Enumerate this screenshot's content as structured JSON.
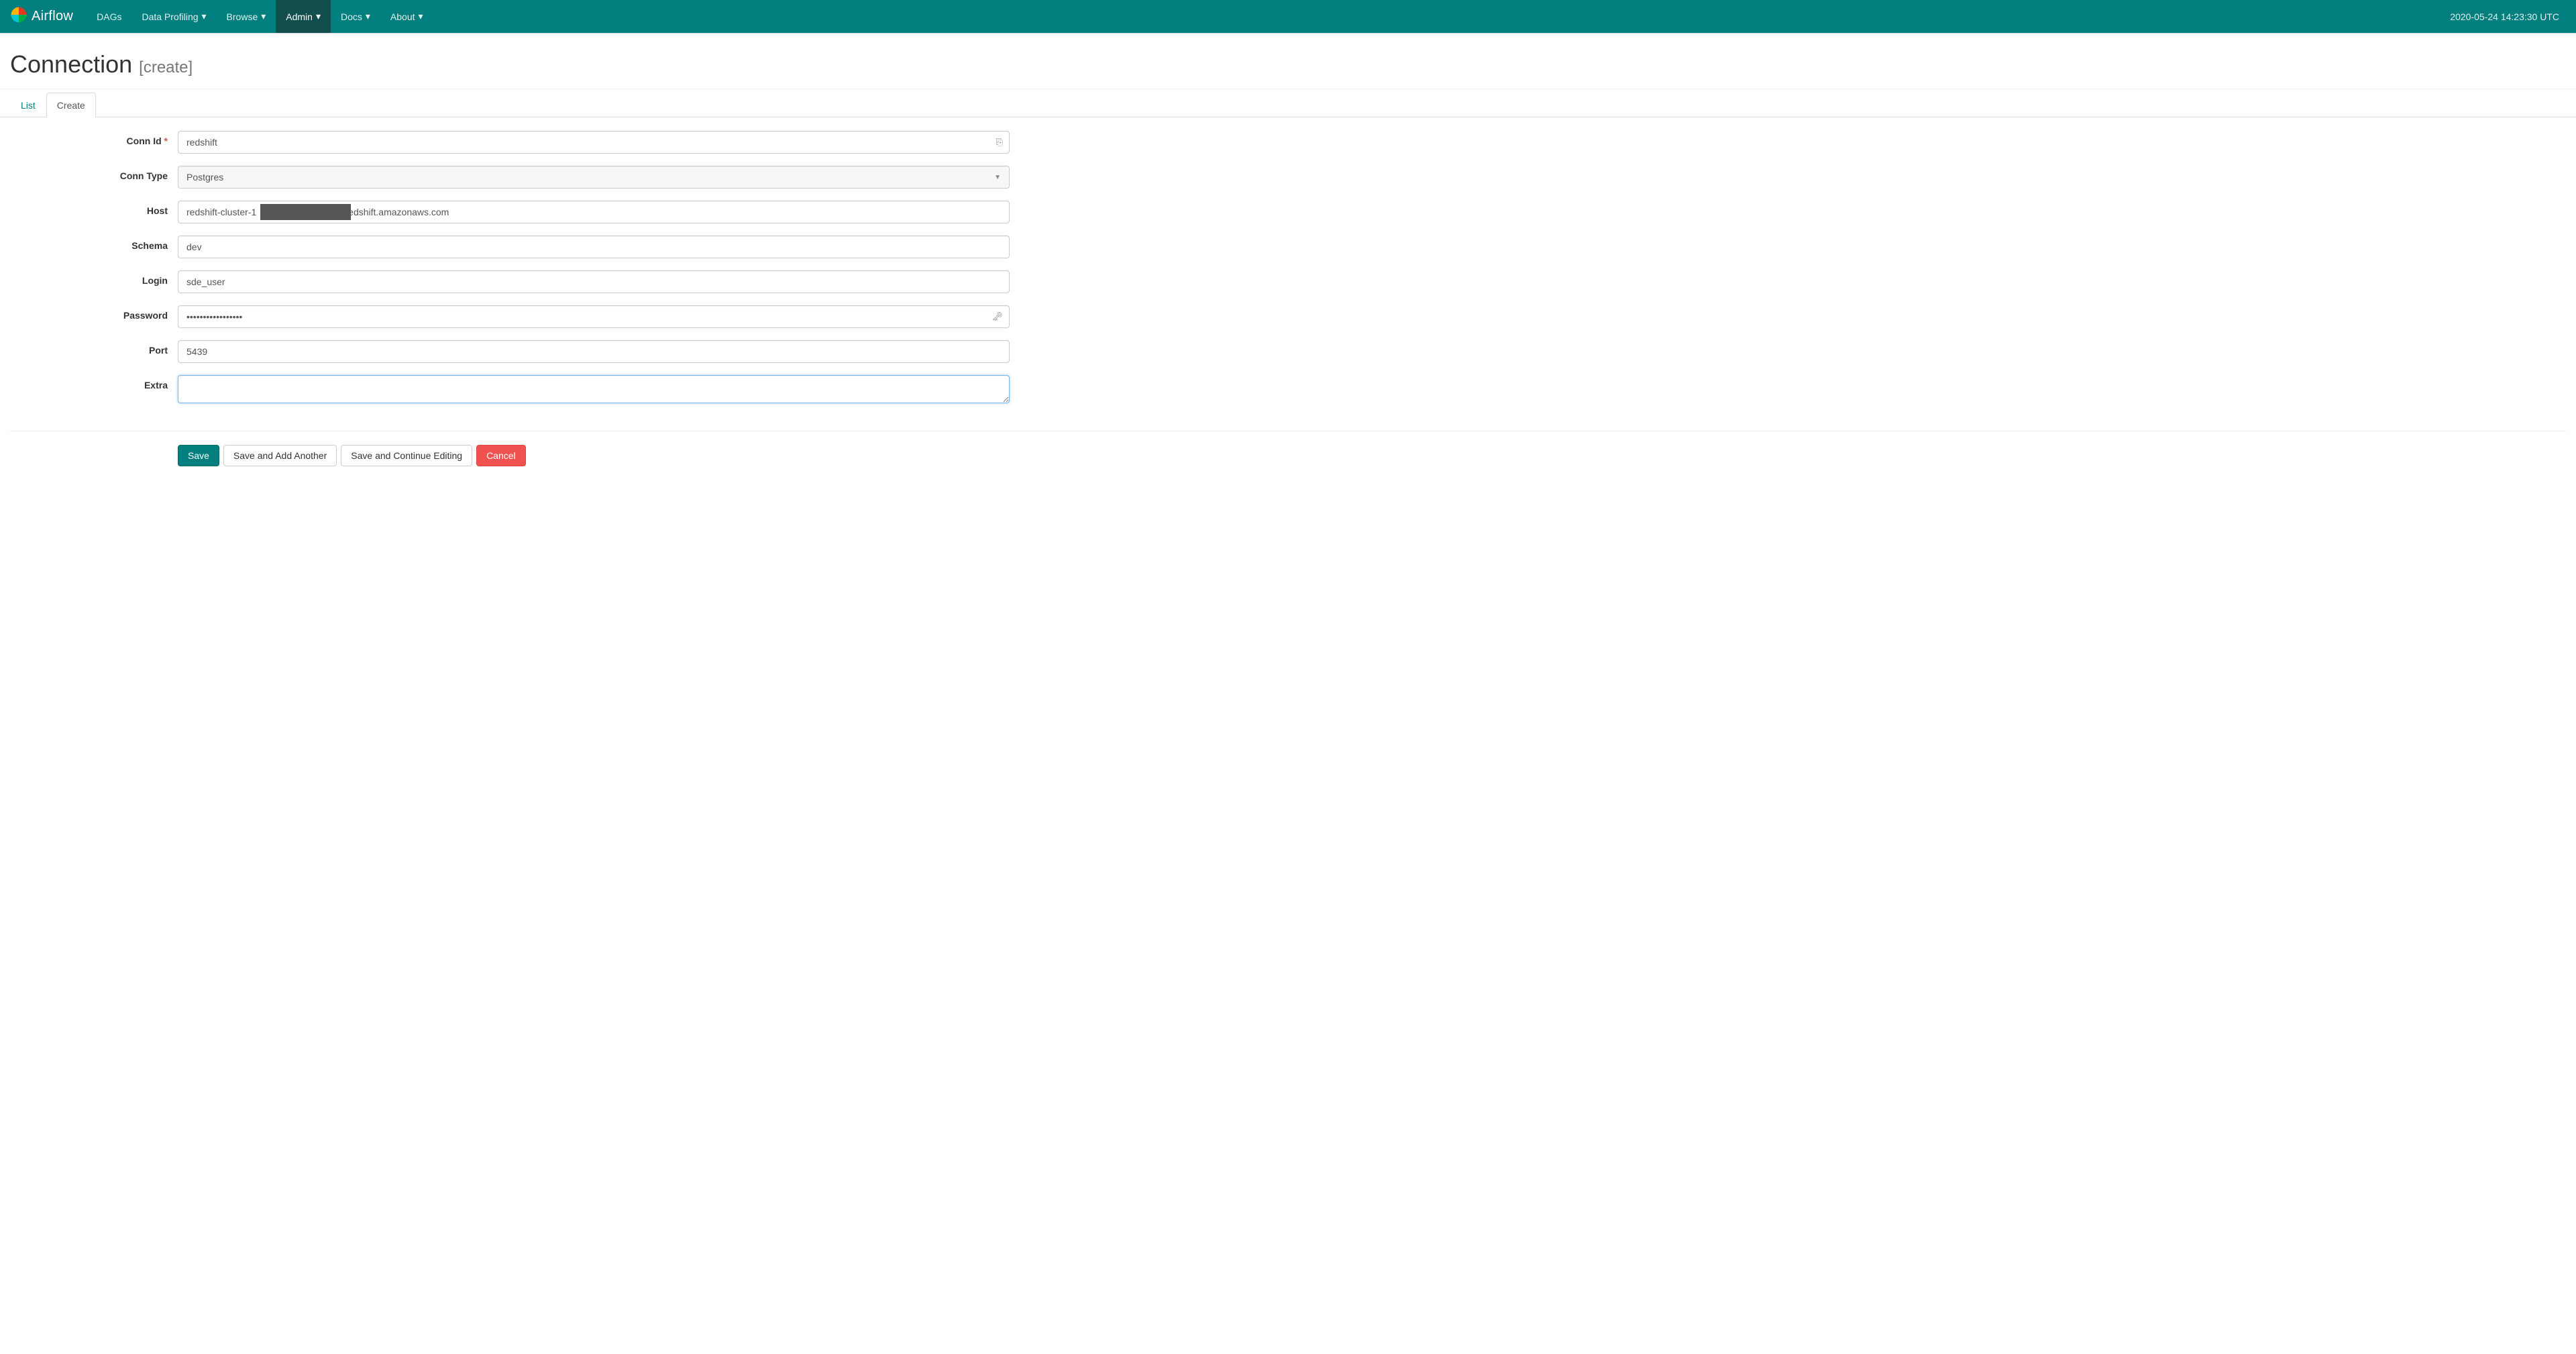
{
  "navbar": {
    "brand": "Airflow",
    "items": [
      {
        "label": "DAGs",
        "hasCaret": false,
        "active": false
      },
      {
        "label": "Data Profiling",
        "hasCaret": true,
        "active": false
      },
      {
        "label": "Browse",
        "hasCaret": true,
        "active": false
      },
      {
        "label": "Admin",
        "hasCaret": true,
        "active": true
      },
      {
        "label": "Docs",
        "hasCaret": true,
        "active": false
      },
      {
        "label": "About",
        "hasCaret": true,
        "active": false
      }
    ],
    "timestamp": "2020-05-24 14:23:30 UTC"
  },
  "header": {
    "title": "Connection",
    "subtitle": "[create]"
  },
  "tabs": {
    "list": "List",
    "create": "Create"
  },
  "form": {
    "labels": {
      "conn_id": "Conn Id",
      "conn_type": "Conn Type",
      "host": "Host",
      "schema": "Schema",
      "login": "Login",
      "password": "Password",
      "port": "Port",
      "extra": "Extra"
    },
    "values": {
      "conn_id": "redshift",
      "conn_type": "Postgres",
      "host": "redshift-cluster-1                                  redshift.amazonaws.com",
      "schema": "dev",
      "login": "sde_user",
      "password": "•••••••••••••••••",
      "port": "5439",
      "extra": ""
    }
  },
  "buttons": {
    "save": "Save",
    "save_add": "Save and Add Another",
    "save_continue": "Save and Continue Editing",
    "cancel": "Cancel"
  }
}
